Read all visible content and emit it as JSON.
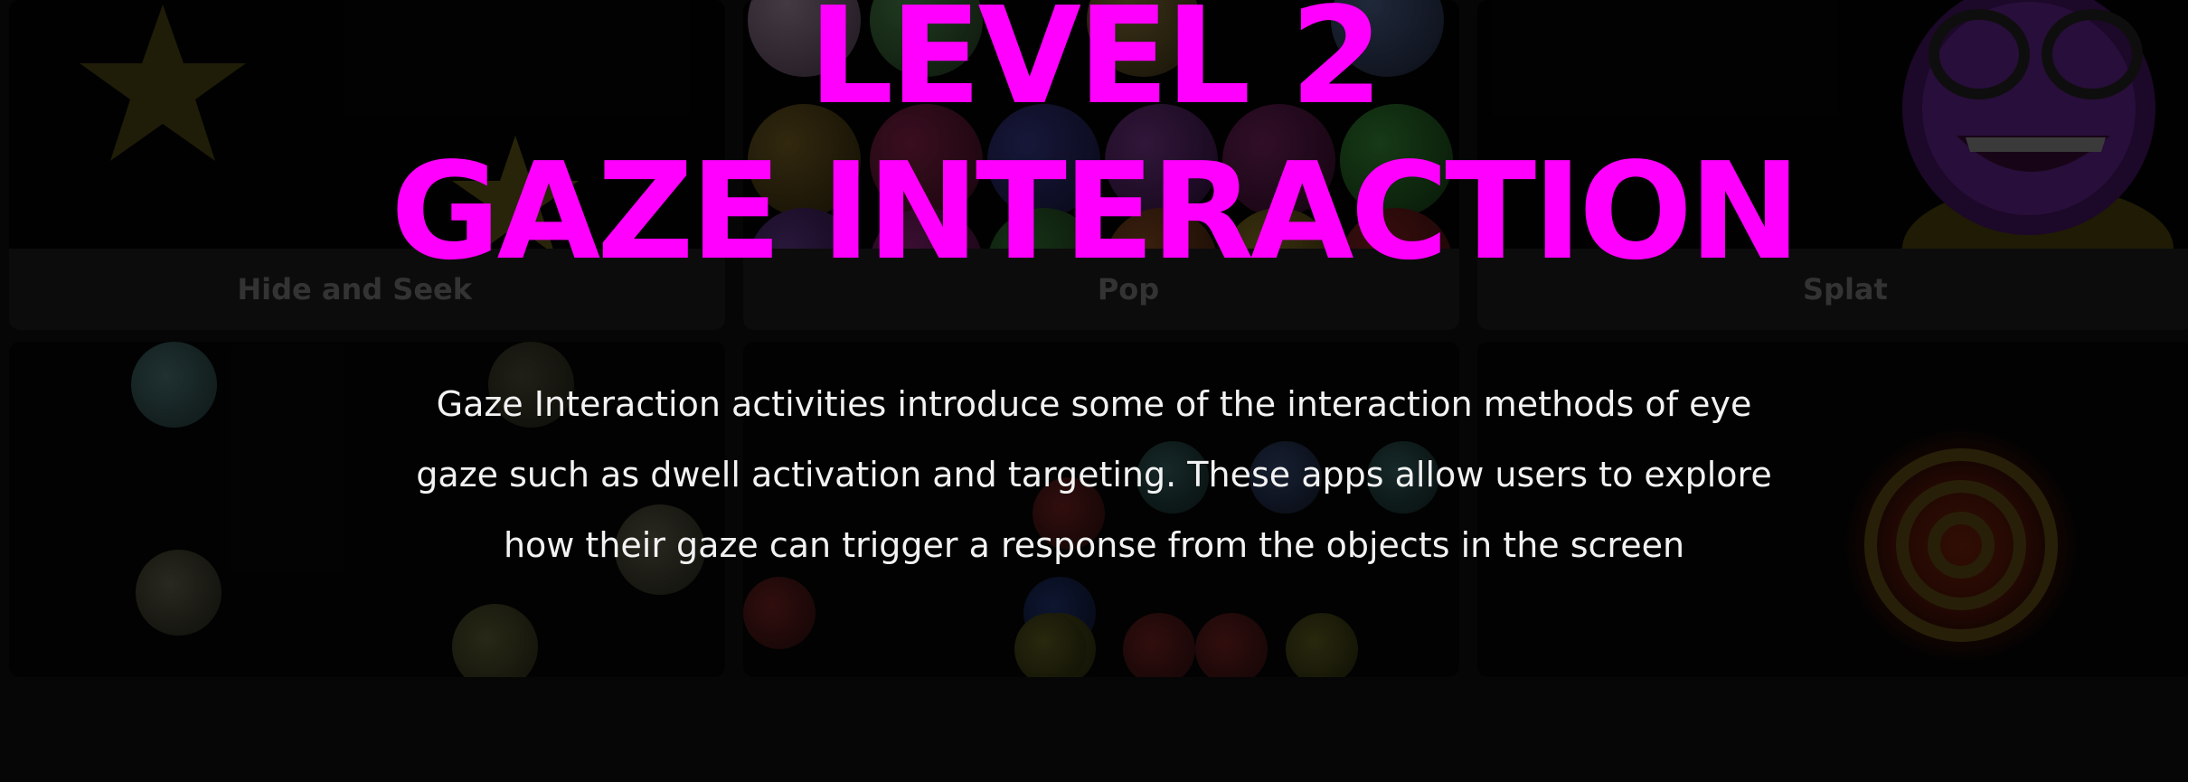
{
  "level_title": "LEVEL 2",
  "section_title": "GAZE INTERACTION",
  "description": "Gaze Interaction activities introduce some of the interaction methods of eye gaze such as dwell activation and targeting. These apps allow users to explore how their gaze can trigger a response from the objects in the screen",
  "activities": [
    {
      "label": "Hide and Seek",
      "icon": "star-icon"
    },
    {
      "label": "Pop",
      "icon": "bubbles-icon"
    },
    {
      "label": "Splat",
      "icon": "splat-smiley-icon"
    }
  ],
  "colors": {
    "accent": "#ff00ff",
    "background": "#0b0b0b",
    "text": "#f2f2f2"
  }
}
